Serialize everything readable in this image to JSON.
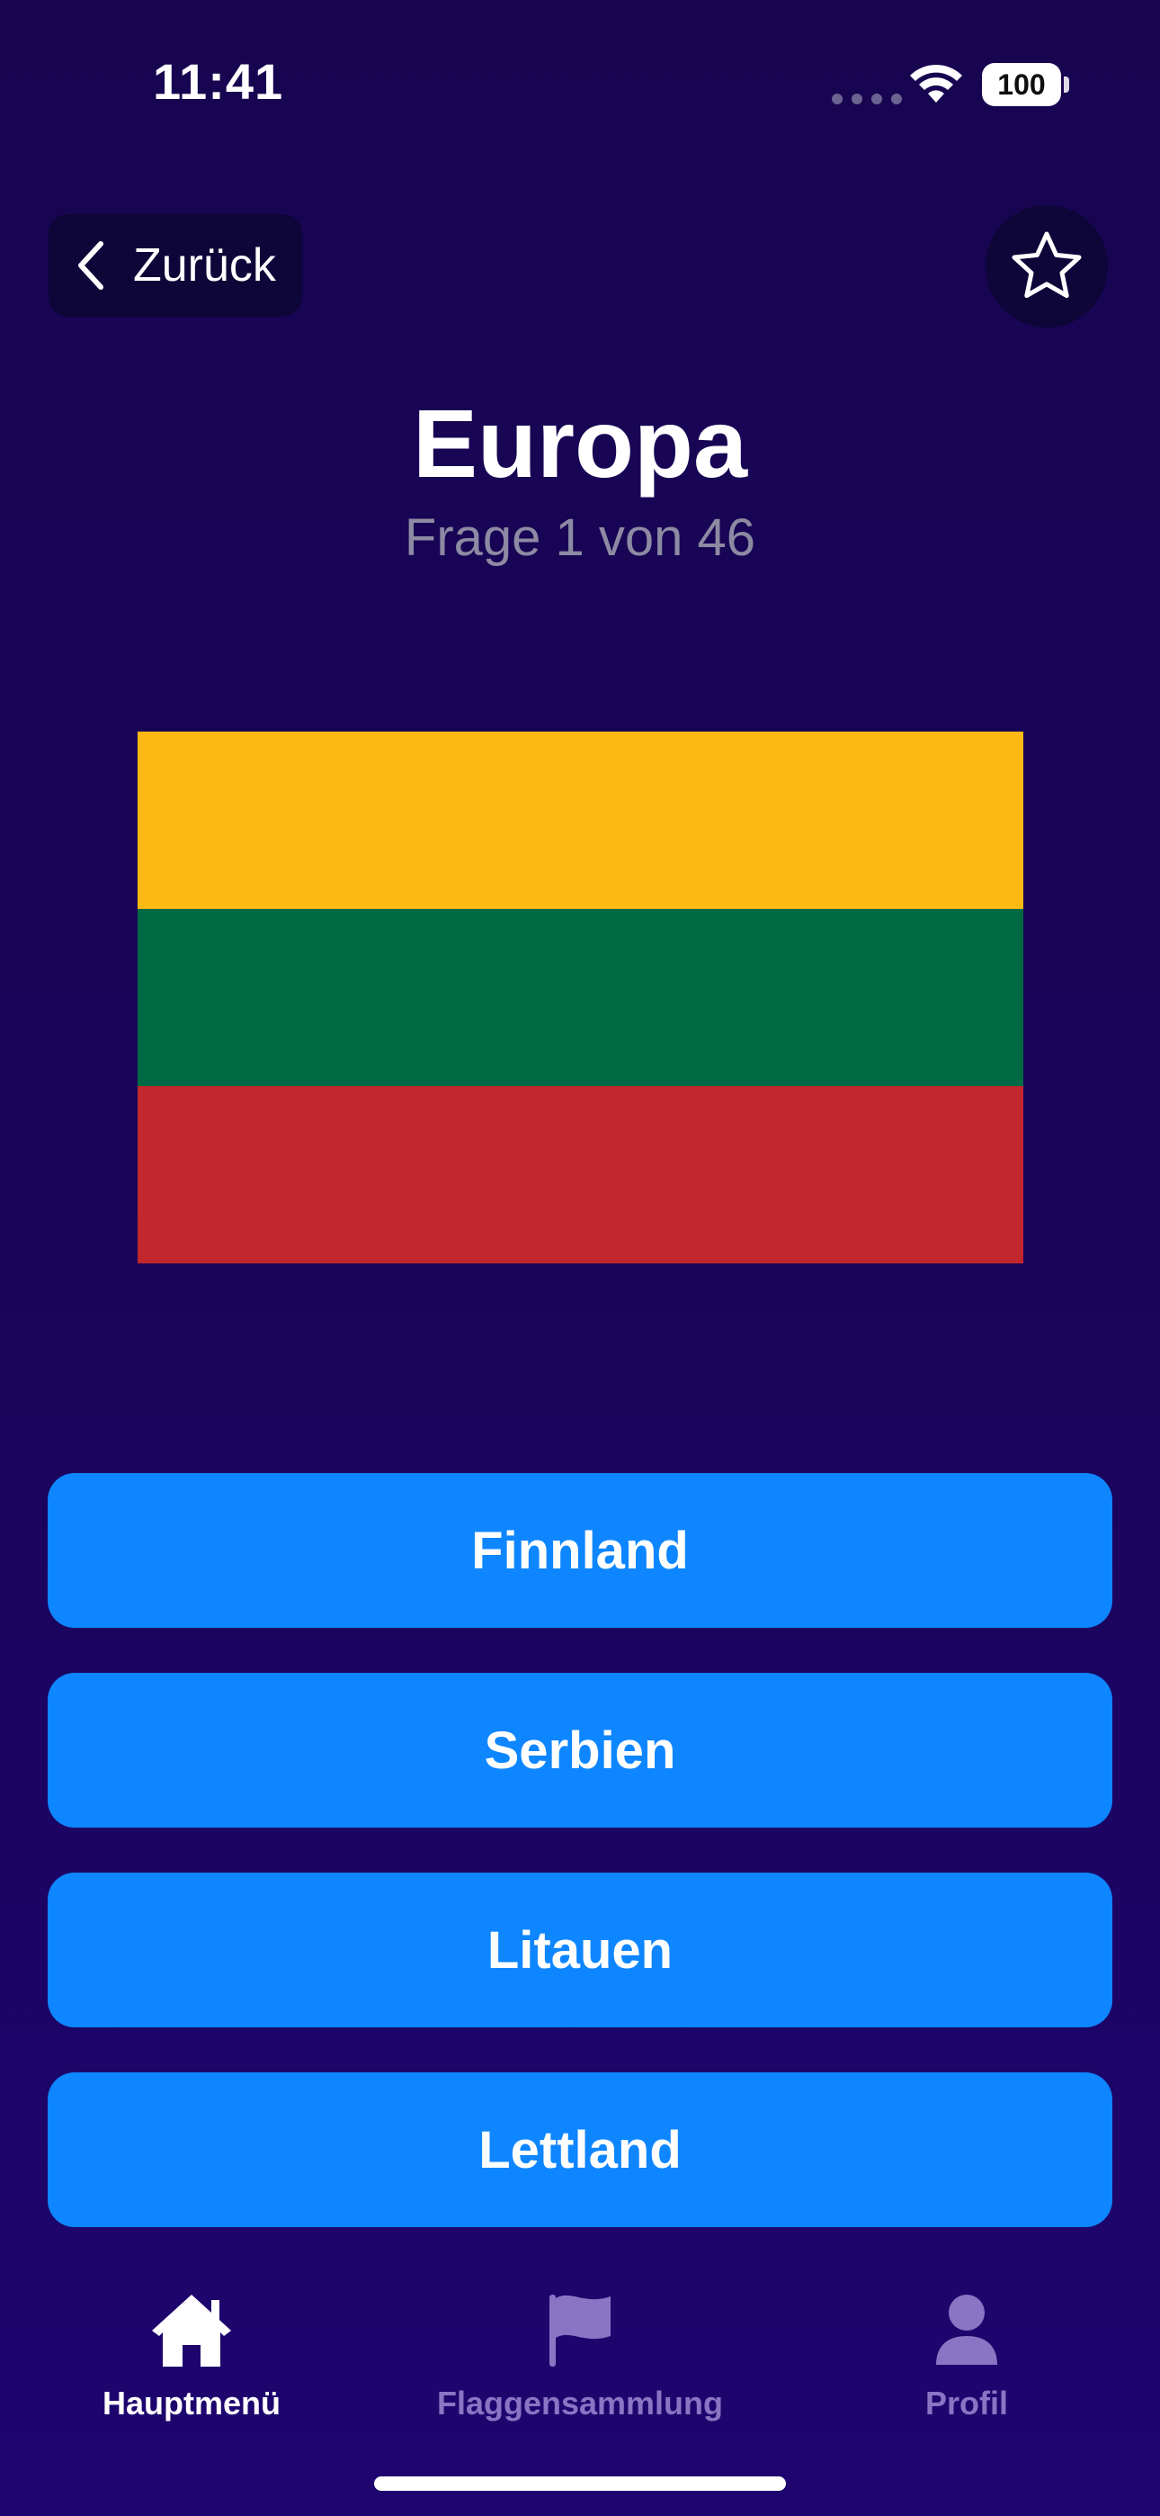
{
  "status_bar": {
    "time": "11:41",
    "battery": "100",
    "icons": [
      "signal-icon",
      "wifi-icon",
      "battery-icon"
    ]
  },
  "nav": {
    "back_label": "Zurück",
    "back_icon": "chevron-left-icon",
    "favorite_icon": "star-outline-icon"
  },
  "quiz": {
    "title": "Europa",
    "progress": "Frage 1 von 46",
    "current_question": 1,
    "total_questions": 46
  },
  "flag": {
    "stripes": [
      "#fdb913",
      "#006a44",
      "#c1272d"
    ]
  },
  "answers": [
    {
      "label": "Finnland"
    },
    {
      "label": "Serbien"
    },
    {
      "label": "Litauen"
    },
    {
      "label": "Lettland"
    }
  ],
  "tab_bar": {
    "items": [
      {
        "label": "Hauptmenü",
        "icon": "house-icon",
        "active": true
      },
      {
        "label": "Flaggensammlung",
        "icon": "flag-icon",
        "active": false
      },
      {
        "label": "Profil",
        "icon": "person-icon",
        "active": false
      }
    ]
  },
  "colors": {
    "background": "#1a045c",
    "accent": "#0e86ff",
    "inactive_tab": "#8a74c4"
  }
}
